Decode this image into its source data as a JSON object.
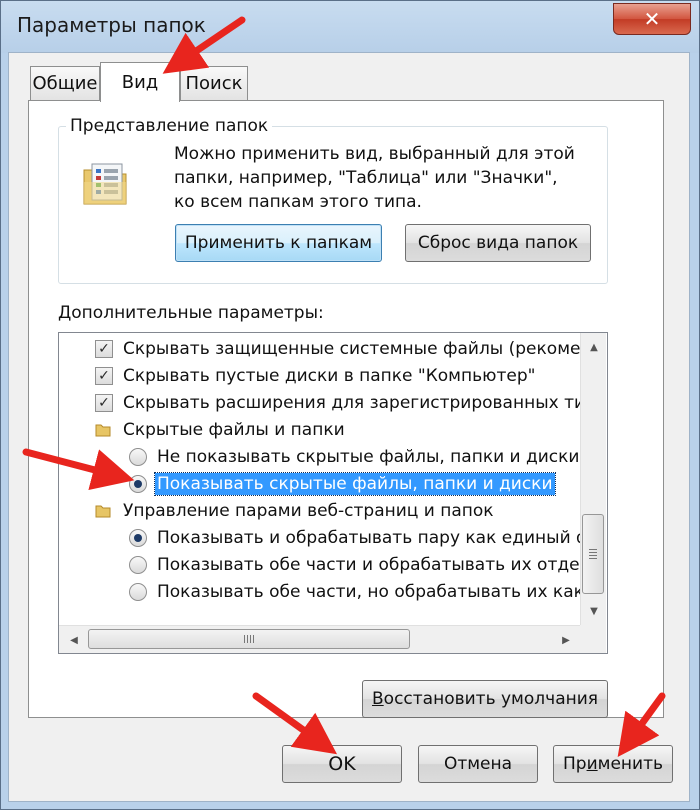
{
  "window": {
    "title": "Параметры папок",
    "close_glyph": "✕"
  },
  "tabs": [
    {
      "label": "Общие",
      "active": false
    },
    {
      "label": "Вид",
      "active": true
    },
    {
      "label": "Поиск",
      "active": false
    }
  ],
  "folder_views": {
    "group_label": "Представление папок",
    "description_lines": [
      "Можно применить вид, выбранный для этой",
      "папки, например, \"Таблица\" или \"Значки\",",
      "ко всем папкам этого типа."
    ],
    "apply_button": "Применить к папкам",
    "reset_button": "Сброс вида папок"
  },
  "advanced": {
    "label": "Дополнительные параметры:",
    "items": [
      {
        "type": "checkbox",
        "checked": true,
        "label": "Скрывать защищенные системные файлы (рекомен"
      },
      {
        "type": "checkbox",
        "checked": true,
        "label": "Скрывать пустые диски в папке \"Компьютер\""
      },
      {
        "type": "checkbox",
        "checked": true,
        "label": "Скрывать расширения для зарегистрированных типо"
      },
      {
        "type": "folder",
        "label": "Скрытые файлы и папки"
      },
      {
        "type": "radio",
        "checked": false,
        "label": "Не показывать скрытые файлы, папки и диски"
      },
      {
        "type": "radio",
        "checked": true,
        "selected": true,
        "label": "Показывать скрытые файлы, папки и диски"
      },
      {
        "type": "folder",
        "label": "Управление парами веб-страниц и папок"
      },
      {
        "type": "radio",
        "checked": true,
        "label": "Показывать и обрабатывать пару как единый фа"
      },
      {
        "type": "radio",
        "checked": false,
        "label": "Показывать обе части и обрабатывать их отдель"
      },
      {
        "type": "radio",
        "checked": false,
        "label": "Показывать обе части, но обрабатывать их как е"
      }
    ],
    "check_glyph": "✓"
  },
  "restore_button": {
    "underlined": "В",
    "rest": "осстановить умолчания"
  },
  "dialog_buttons": {
    "ok": "OK",
    "cancel": "Отмена",
    "apply": {
      "before": "Пр",
      "underlined": "и",
      "after": "менить"
    }
  },
  "colors": {
    "annotation_arrow": "#e8251e",
    "selection": "#3399ff",
    "close_button": "#c8432c"
  },
  "icons": {
    "close": "close-icon",
    "folder_options": "folder-options-icon",
    "folder": "folder-icon",
    "scroll_up": "scroll-up-arrow-icon",
    "scroll_down": "scroll-down-arrow-icon",
    "scroll_left": "scroll-left-arrow-icon",
    "scroll_right": "scroll-right-arrow-icon",
    "annotation": "red-arrow-icon"
  }
}
